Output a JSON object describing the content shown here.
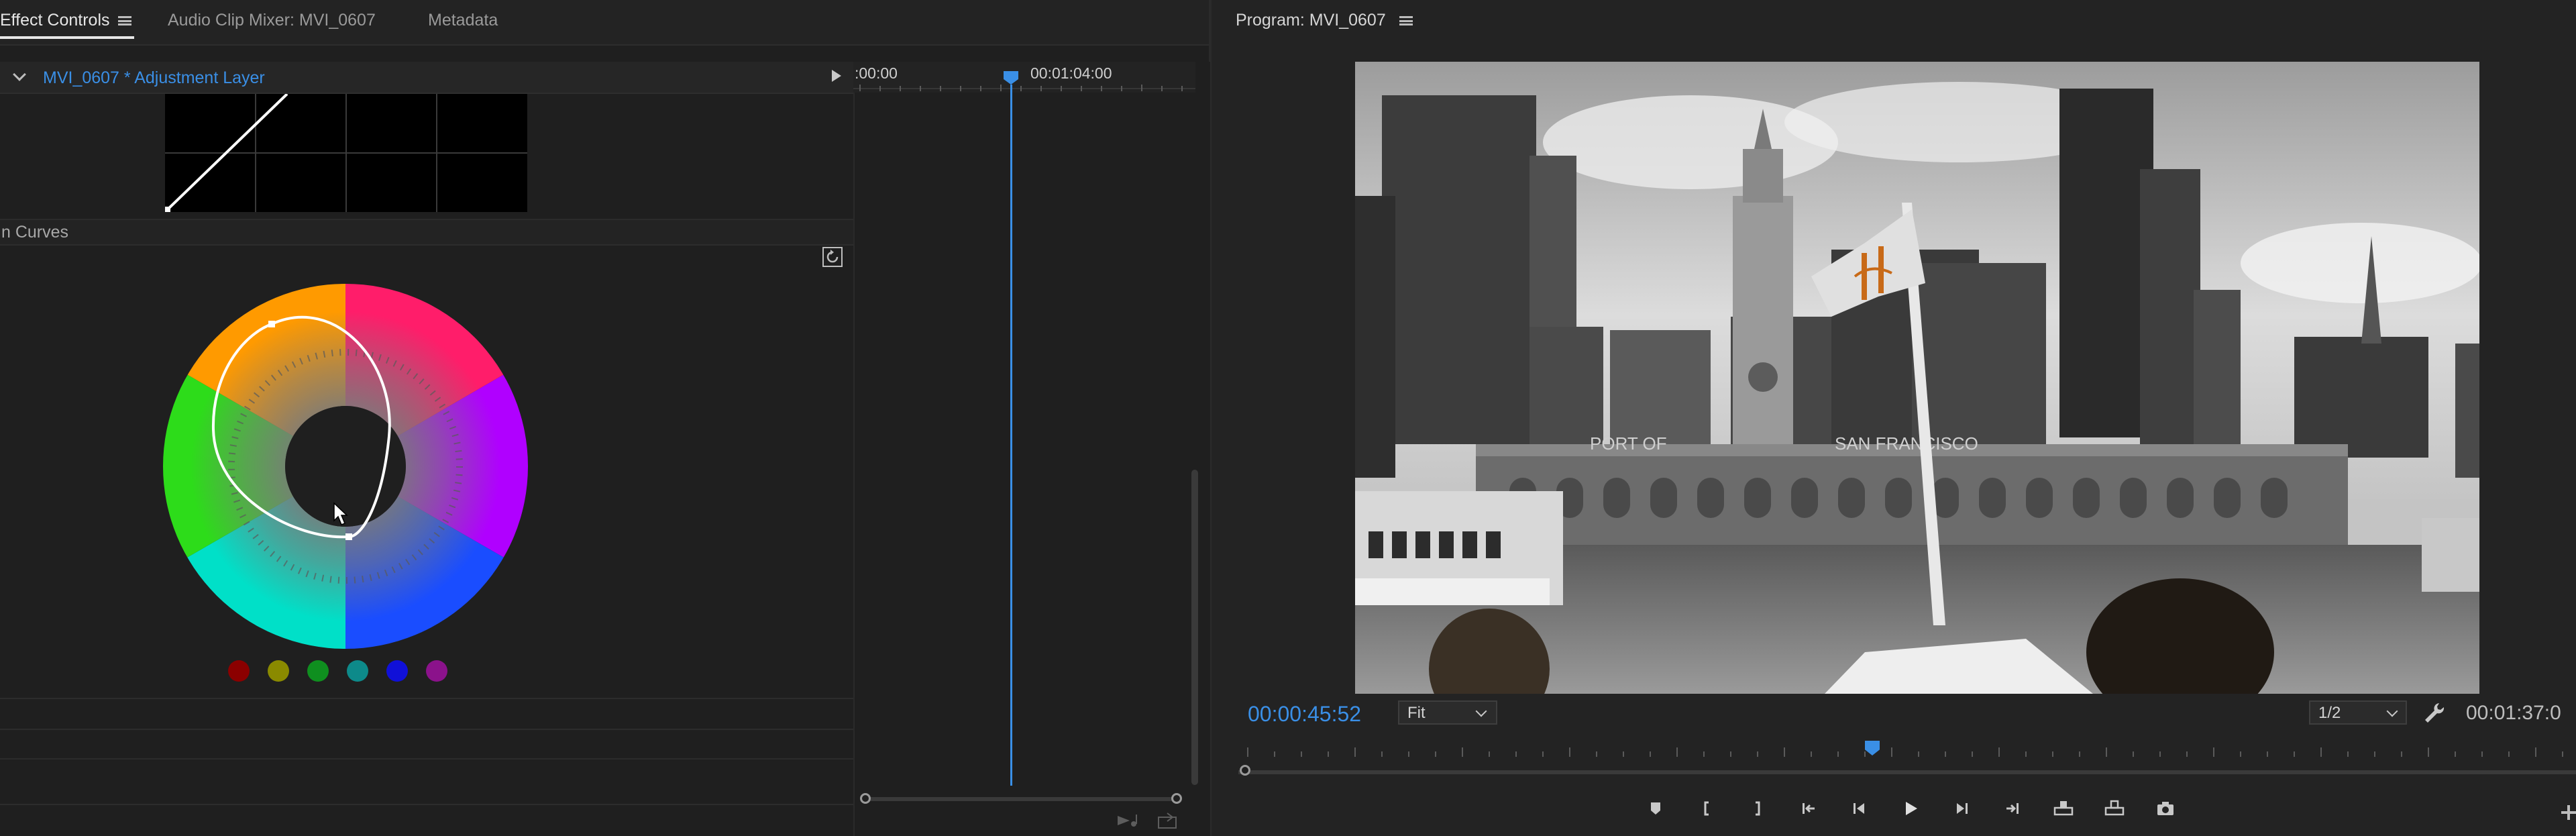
{
  "left_panel": {
    "tabs": [
      {
        "label": "Effect Controls",
        "active": true
      },
      {
        "label": "Audio Clip Mixer: MVI_0607",
        "active": false
      },
      {
        "label": "Metadata",
        "active": false
      }
    ],
    "clip_header": "MVI_0607 * Adjustment Layer",
    "section_title": "n Curves",
    "swatch_colors": [
      "#8b0000",
      "#8a8a00",
      "#0f8f1f",
      "#0d8a8a",
      "#1010d8",
      "#8b128b"
    ],
    "timeline": {
      "time_start": ":00:00",
      "time_mark": "00:01:04:00"
    }
  },
  "program_monitor": {
    "title": "Program: MVI_0607",
    "timecode": "00:00:45:52",
    "zoom": "Fit",
    "resolution": "1/2",
    "duration": "00:01:37:0",
    "frame_signs": {
      "port": "PORT OF",
      "city": "SAN FRANCISCO"
    }
  },
  "colors": {
    "accent": "#3a8fe6"
  }
}
